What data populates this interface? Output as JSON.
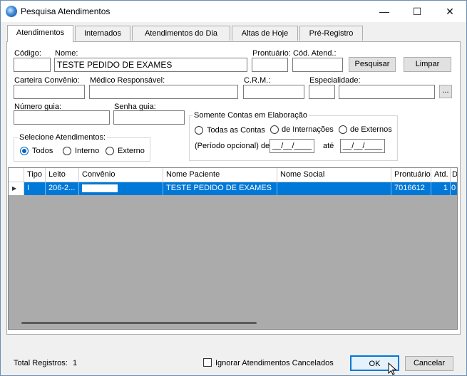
{
  "window": {
    "title": "Pesquisa Atendimentos",
    "controls": {
      "minimize": "—",
      "maximize": "☐",
      "close": "✕"
    }
  },
  "tabs": [
    "Atendimentos",
    "Internados",
    "Atendimentos do Dia",
    "Altas de Hoje",
    "Pré-Registro"
  ],
  "form": {
    "codigo_label": "Código:",
    "codigo_value": "",
    "nome_label": "Nome:",
    "nome_value": "TESTE PEDIDO DE EXAMES",
    "prontuario_label": "Prontuário:",
    "prontuario_value": "",
    "cod_atend_label": "Cód. Atend.:",
    "cod_atend_value": "",
    "pesquisar_button": "Pesquisar",
    "limpar_button": "Limpar",
    "carteira_label": "Carteira Convênio:",
    "medico_label": "Médico Responsável:",
    "crm_label": "C.R.M.:",
    "especialidade_label": "Especialidade:",
    "ellipsis_button": "...",
    "numero_guia_label": "Número guia:",
    "senha_guia_label": "Senha guia:"
  },
  "contas_group": {
    "title": "Somente Contas em Elaboração",
    "options": [
      "Todas as Contas",
      "de Internações",
      "de Externos"
    ],
    "periodo_label": "(Período opcional) de",
    "date_from": "__/__/____",
    "ate_label": "até",
    "date_to": "__/__/____"
  },
  "atend_group": {
    "title": "Selecione Atendimentos:",
    "options": [
      "Todos",
      "Interno",
      "Externo"
    ],
    "selected": "Todos"
  },
  "grid": {
    "columns": [
      "Tipo",
      "Leito",
      "Convênio",
      "Nome Paciente",
      "Nome Social",
      "Prontuário",
      "Atd.",
      "D"
    ],
    "rows": [
      {
        "tipo": "I",
        "leito": "206-2...",
        "convenio": "",
        "nome_paciente": "TESTE PEDIDO DE EXAMES",
        "nome_social": "",
        "prontuario": "7016612",
        "atd": "1",
        "d": "0"
      }
    ],
    "row_indicator": "▶"
  },
  "footer": {
    "total_label": "Total Registros:",
    "total_value": "1",
    "ignorar_label": "Ignorar Atendimentos Cancelados",
    "ok_button": "OK",
    "cancelar_button": "Cancelar"
  },
  "colors": {
    "selection": "#0078d7",
    "grid_background": "#ababab",
    "radio_accent": "#0067c0"
  }
}
